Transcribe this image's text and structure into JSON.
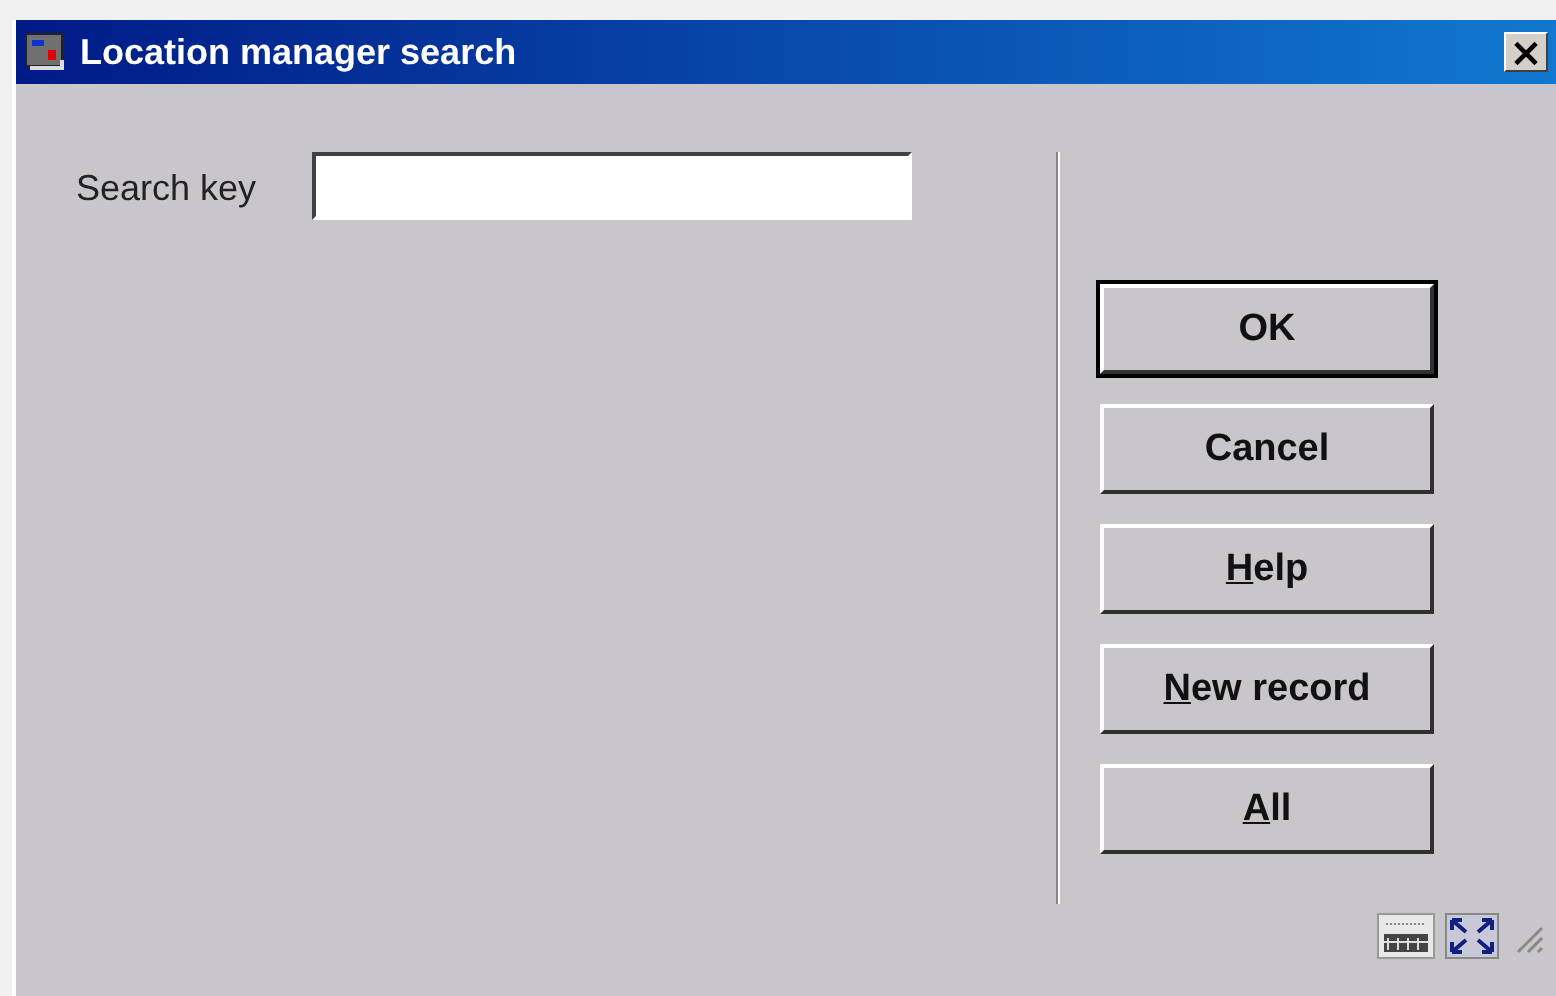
{
  "window": {
    "title": "Location manager search",
    "close_label": "×"
  },
  "form": {
    "label": "Search key"
  },
  "buttons": [
    {
      "label": "OK",
      "default": true,
      "underline_first": false
    },
    {
      "label": "Cancel",
      "default": false,
      "underline_first": false
    },
    {
      "label": "Help",
      "default": false,
      "underline_first": true
    },
    {
      "label": "New record",
      "default": false,
      "underline_first": true
    },
    {
      "label": "All",
      "default": false,
      "underline_first": true
    }
  ]
}
